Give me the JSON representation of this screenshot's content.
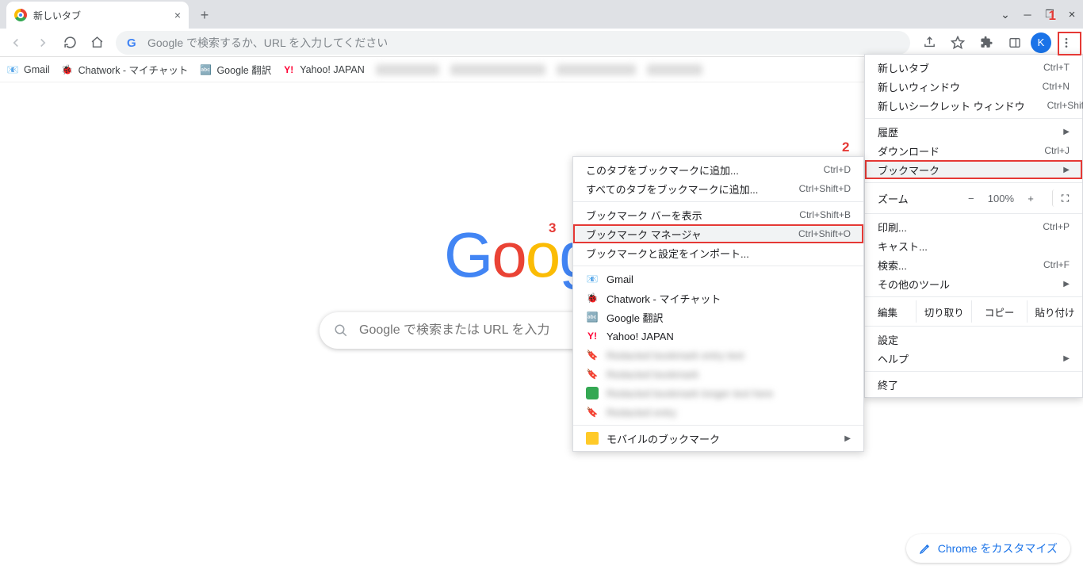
{
  "tab": {
    "title": "新しいタブ"
  },
  "addressbar": {
    "placeholder": "Google で検索するか、URL を入力してください"
  },
  "avatar_letter": "K",
  "bookmarks_bar": [
    {
      "icon": "gmail",
      "label": "Gmail"
    },
    {
      "icon": "chatwork",
      "label": "Chatwork - マイチャット"
    },
    {
      "icon": "gtranslate",
      "label": "Google 翻訳"
    },
    {
      "icon": "yahoo",
      "label": "Yahoo! JAPAN"
    }
  ],
  "google_logo_letters": "Google",
  "search_placeholder": "Google で検索または URL を入力",
  "customize_label": "Chrome をカスタマイズ",
  "mainmenu": {
    "newtab": {
      "label": "新しいタブ",
      "shortcut": "Ctrl+T"
    },
    "newwin": {
      "label": "新しいウィンドウ",
      "shortcut": "Ctrl+N"
    },
    "incog": {
      "label": "新しいシークレット ウィンドウ",
      "shortcut": "Ctrl+Shift+N"
    },
    "history": {
      "label": "履歴"
    },
    "downloads": {
      "label": "ダウンロード",
      "shortcut": "Ctrl+J"
    },
    "bookmarks": {
      "label": "ブックマーク"
    },
    "zoom": {
      "label": "ズーム",
      "value": "100%"
    },
    "print": {
      "label": "印刷...",
      "shortcut": "Ctrl+P"
    },
    "cast": {
      "label": "キャスト..."
    },
    "find": {
      "label": "検索...",
      "shortcut": "Ctrl+F"
    },
    "moretools": {
      "label": "その他のツール"
    },
    "edit": {
      "label": "編集",
      "cut": "切り取り",
      "copy": "コピー",
      "paste": "貼り付け"
    },
    "settings": {
      "label": "設定"
    },
    "help": {
      "label": "ヘルプ"
    },
    "exit": {
      "label": "終了"
    }
  },
  "submenu": {
    "add_this": {
      "label": "このタブをブックマークに追加...",
      "shortcut": "Ctrl+D"
    },
    "add_all": {
      "label": "すべてのタブをブックマークに追加...",
      "shortcut": "Ctrl+Shift+D"
    },
    "show_bar": {
      "label": "ブックマーク バーを表示",
      "shortcut": "Ctrl+Shift+B"
    },
    "manager": {
      "label": "ブックマーク マネージャ",
      "shortcut": "Ctrl+Shift+O"
    },
    "import": {
      "label": "ブックマークと設定をインポート..."
    },
    "items": [
      {
        "icon": "gmail",
        "label": "Gmail"
      },
      {
        "icon": "chatwork",
        "label": "Chatwork - マイチャット"
      },
      {
        "icon": "gtranslate",
        "label": "Google 翻訳"
      },
      {
        "icon": "yahoo",
        "label": "Yahoo! JAPAN"
      }
    ],
    "mobile": {
      "label": "モバイルのブックマーク"
    }
  },
  "annotations": {
    "one": "1",
    "two": "2",
    "three": "3"
  }
}
